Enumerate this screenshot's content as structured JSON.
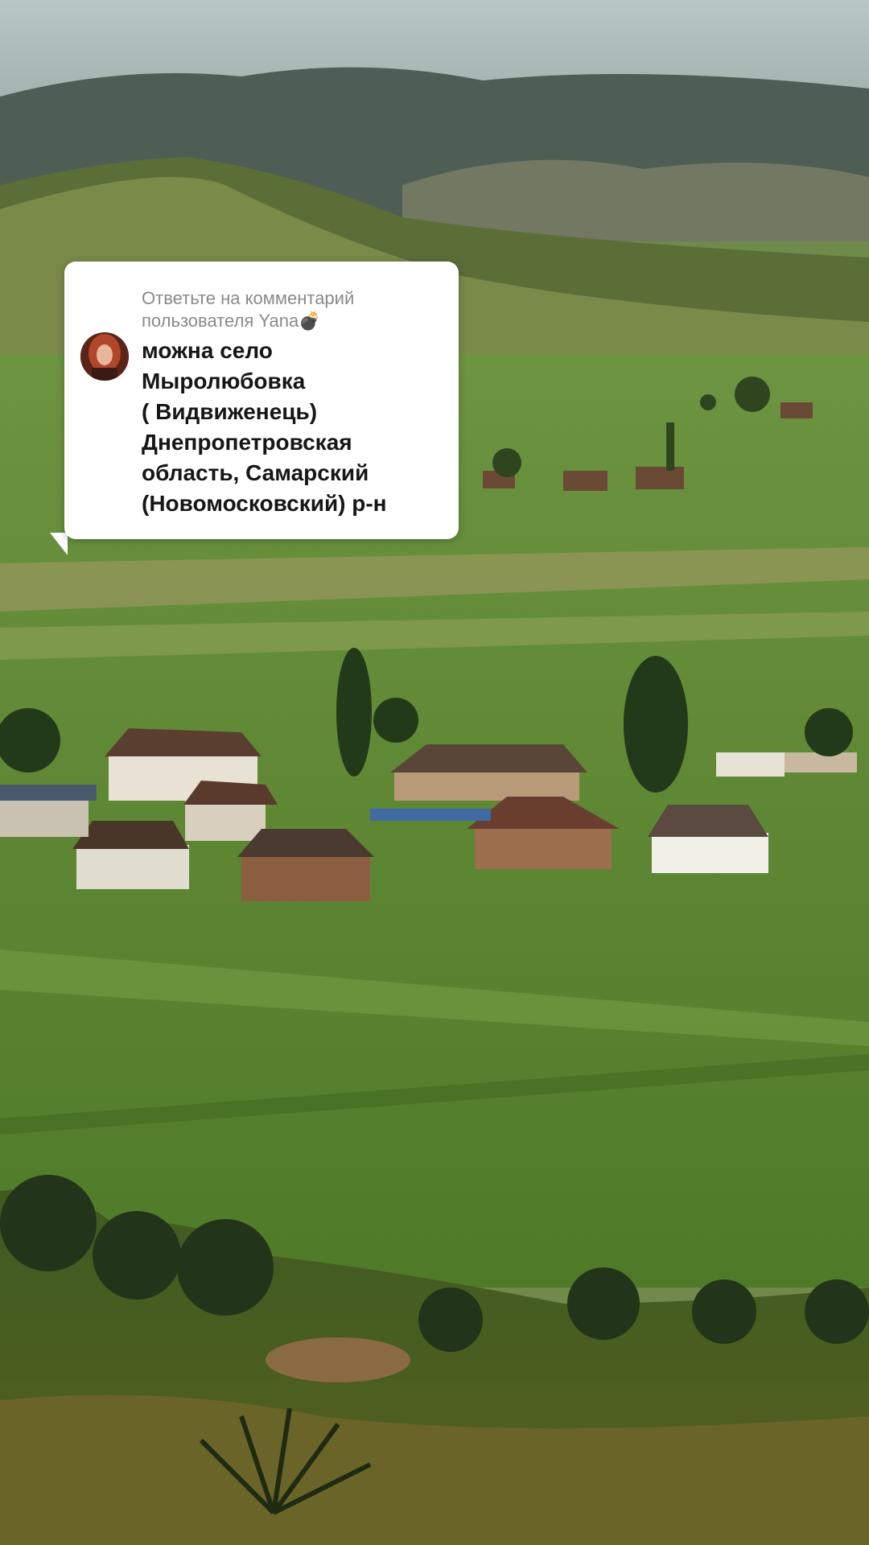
{
  "comment": {
    "reply_label": "Ответьте на комментарий пользователя Yana",
    "reply_emoji": "💣",
    "text": "можна село\nМыролюбовка\n( Видвиженець)\nДнепропетровская\nобласть, Самарский\n(Новомосковский) р-н"
  },
  "colors": {
    "sky": "#b8c4c2",
    "field_green": "#5f8a32",
    "card_bg": "#ffffff",
    "label_gray": "#8a8a8a",
    "text_dark": "#161616"
  }
}
